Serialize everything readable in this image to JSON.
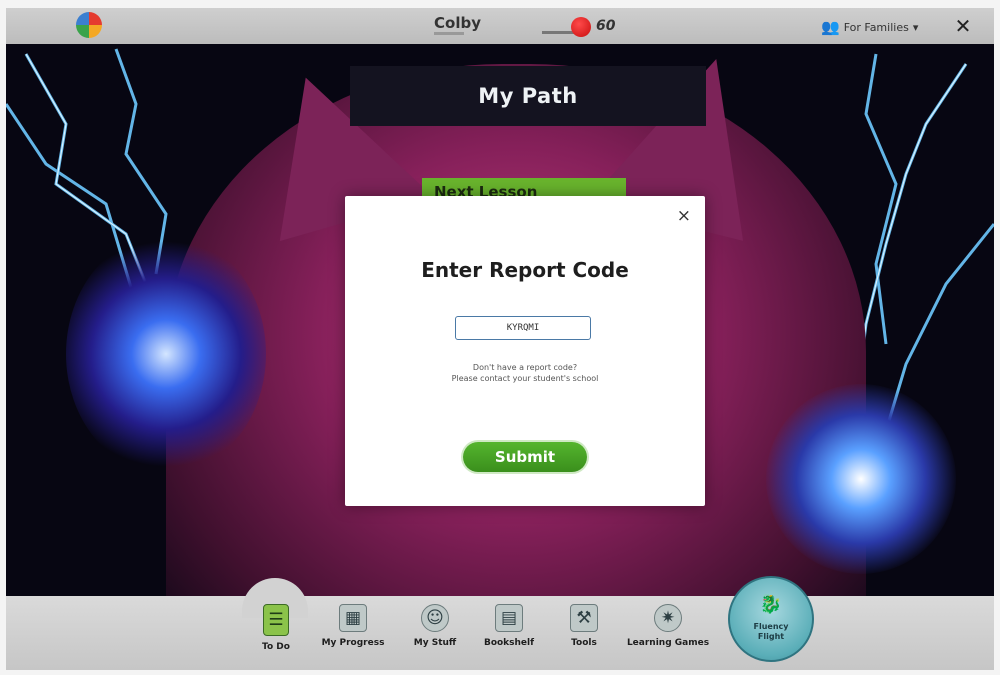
{
  "topbar": {
    "username": "Colby",
    "coin_count": "60",
    "families_label": "For Families",
    "families_caret": "▾",
    "close_glyph": "✕"
  },
  "page": {
    "title": "My Path",
    "next_lesson_label": "Next Lesson"
  },
  "modal": {
    "close_glyph": "×",
    "title": "Enter Report Code",
    "code_value": "KYRQMI",
    "help_question": "Don't have a report code?",
    "help_contact": "Please contact your student's school",
    "submit_label": "Submit"
  },
  "nav": {
    "items": [
      {
        "label": "To Do",
        "icon": "todo-icon"
      },
      {
        "label": "My Progress",
        "icon": "progress-icon"
      },
      {
        "label": "My Stuff",
        "icon": "my-stuff-icon"
      },
      {
        "label": "Bookshelf",
        "icon": "bookshelf-icon"
      },
      {
        "label": "Tools",
        "icon": "tools-icon"
      },
      {
        "label": "Learning Games",
        "icon": "learning-games-icon"
      }
    ],
    "featured_label_1": "Fluency",
    "featured_label_2": "Flight"
  },
  "colors": {
    "accent_green": "#69b42d",
    "coin_red": "#d71a1a",
    "header_dark": "#141320"
  }
}
